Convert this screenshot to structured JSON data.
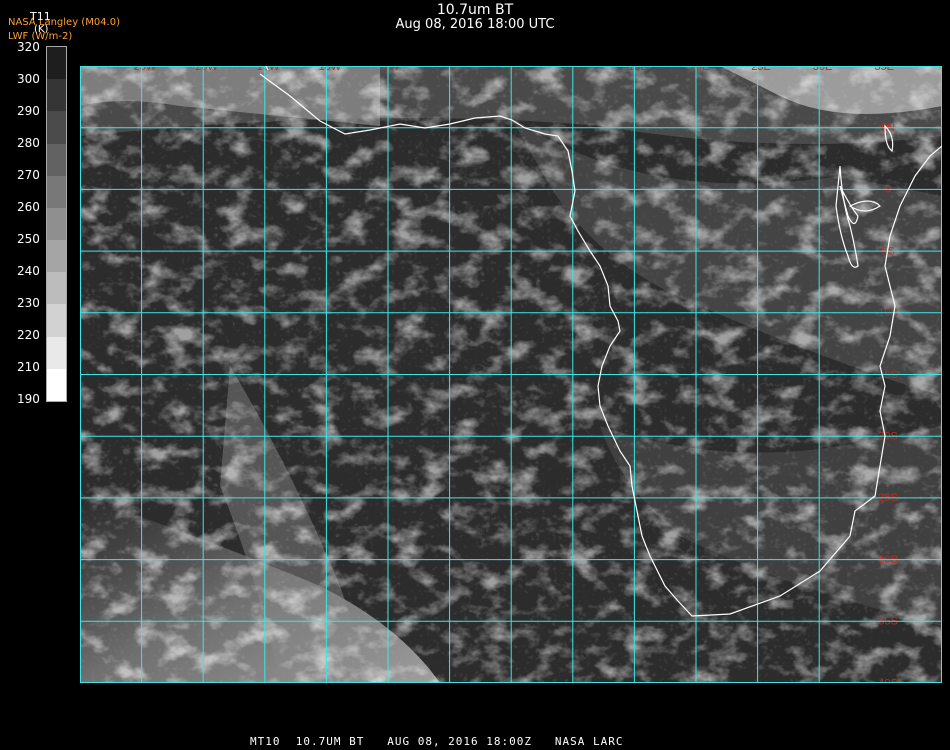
{
  "header": {
    "title": "10.7um BT",
    "subtitle": "Aug 08, 2016 18:00 UTC",
    "source": "NASA Langley (M04.0)",
    "lwf": "LWF (W/m-2)"
  },
  "colorbar": {
    "variable": "T11",
    "unit": "(K)",
    "labels": [
      "320",
      "300",
      "290",
      "280",
      "270",
      "260",
      "250",
      "240",
      "230",
      "220",
      "210",
      "190"
    ]
  },
  "map": {
    "lon_labels": [
      "25W",
      "20W",
      "15W",
      "10W",
      "5W",
      "0",
      "5E",
      "10E",
      "15E",
      "20E",
      "25E",
      "30E",
      "35E"
    ],
    "lat_labels": [
      "5N",
      "0",
      "5S",
      "10S",
      "15S",
      "20S",
      "25S",
      "30S",
      "35S",
      "40S"
    ],
    "grid_color": "#3ce6e6",
    "coast_color": "#ffffff",
    "label_color": "#c8281e"
  },
  "footer": {
    "text": "MT10  10.7UM BT   AUG 08, 2016 18:00Z   NASA LARC"
  }
}
